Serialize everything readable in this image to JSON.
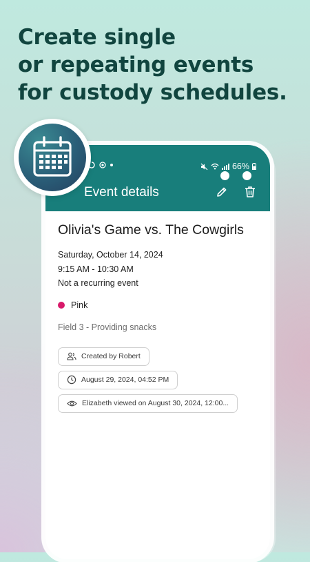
{
  "promo": {
    "headline_line1": "Create single",
    "headline_line2": "or repeating events",
    "headline_line3": "for custody schedules."
  },
  "status_bar": {
    "battery": "66%"
  },
  "app_bar": {
    "title": "Event details",
    "edit_icon": "pencil-icon",
    "delete_icon": "trash-icon"
  },
  "event": {
    "title": "Olivia's Game vs. The Cowgirls",
    "date": "Saturday, October 14, 2024",
    "time": "9:15 AM - 10:30 AM",
    "recurrence": "Not a recurring event",
    "color_name": "Pink",
    "color_hex": "#d81a6a",
    "notes": "Field 3 - Providing snacks"
  },
  "meta_chips": {
    "created_by": "Created by Robert",
    "created_at": "August 29, 2024, 04:52 PM",
    "viewed": "Elizabeth viewed on August 30, 2024, 12:00..."
  },
  "colors": {
    "app_bar": "#187e7b",
    "headline": "#11453f"
  }
}
